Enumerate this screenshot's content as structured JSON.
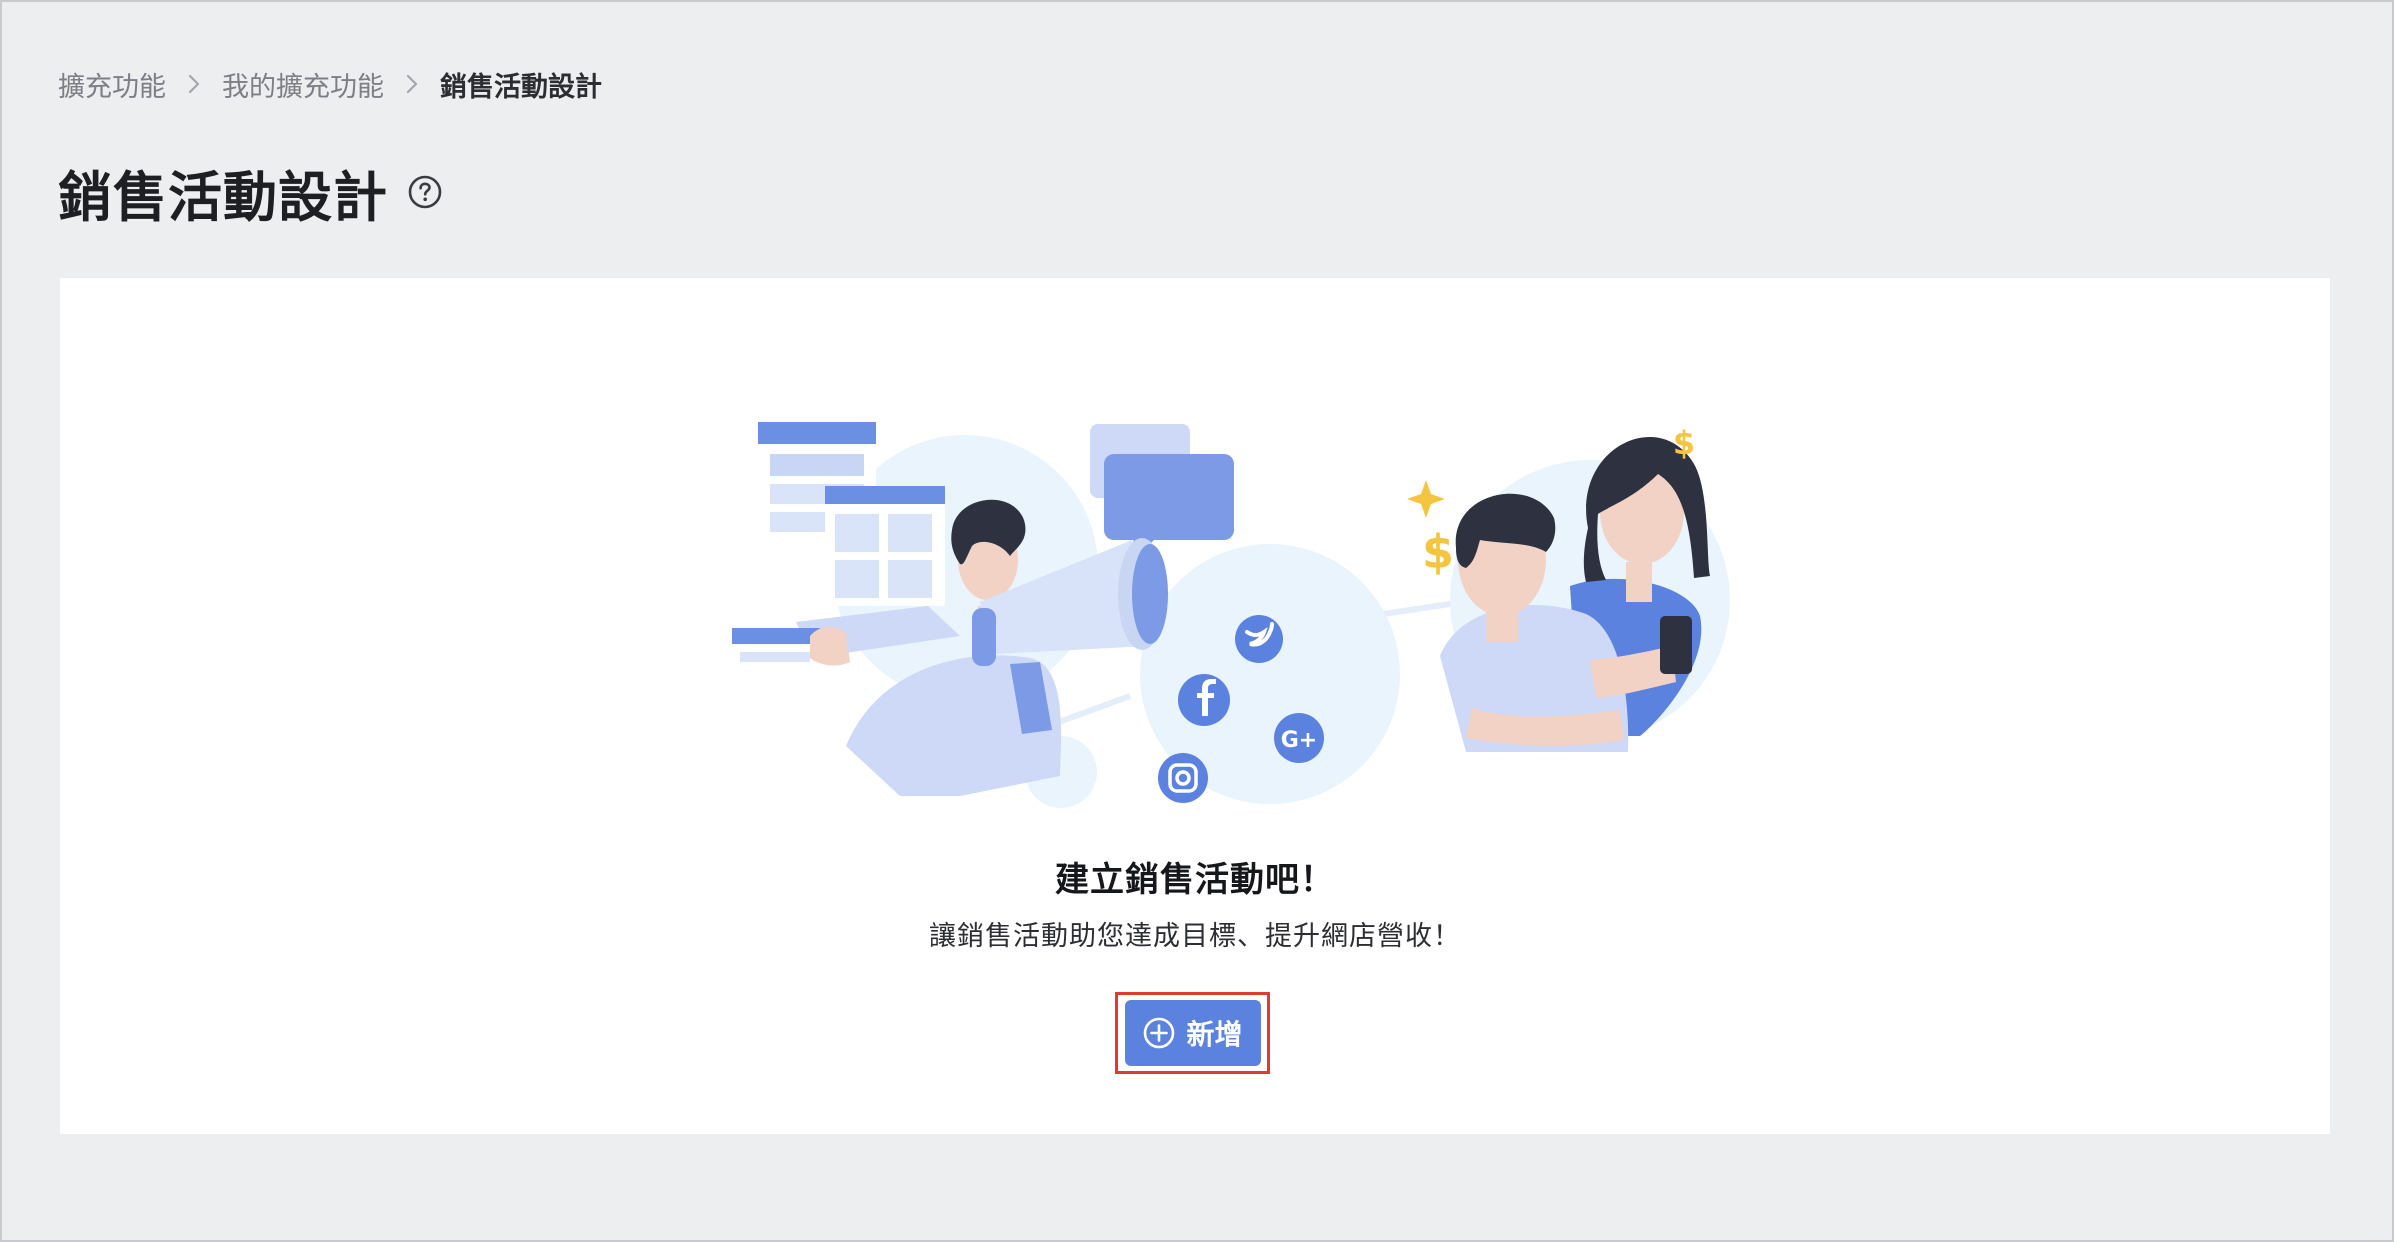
{
  "breadcrumb": {
    "items": [
      "擴充功能",
      "我的擴充功能",
      "銷售活動設計"
    ],
    "separator_icon": "chevron-right-icon"
  },
  "page": {
    "title": "銷售活動設計",
    "help_icon": "question-circle-icon"
  },
  "empty_state": {
    "illustration": "marketing-campaign-illustration",
    "title": "建立銷售活動吧！",
    "description": "讓銷售活動助您達成目標、提升網店營收！",
    "add_button_label": "新增",
    "add_button_icon": "plus-circle-icon"
  },
  "colors": {
    "page_background": "#edeef0",
    "card_background": "#ffffff",
    "primary": "#5c82e0",
    "highlight_border": "#e23b2e",
    "illustration_light": "#cdd9f6",
    "illustration_bg": "#eaf4fc",
    "accent_yellow": "#f5c542"
  }
}
